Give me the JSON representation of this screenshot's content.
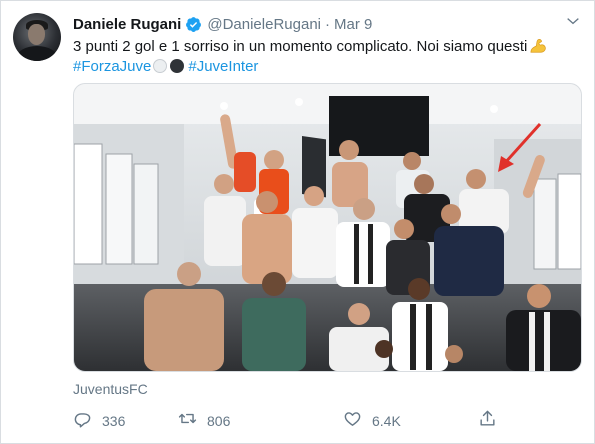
{
  "tweet": {
    "author_name": "Daniele Rugani",
    "handle": "@DanieleRugani",
    "separator": "·",
    "date": "Mar 9",
    "text_line1": "3 punti 2 gol e 1 sorriso in un momento complicato. Noi siamo questi",
    "hashtags": [
      "#ForzaJuve",
      "#JuveInter"
    ],
    "source": "JuventusFC",
    "stats": {
      "replies": "336",
      "retweets": "806",
      "likes": "6.4K"
    }
  },
  "icons": {
    "verified": "verified-badge-icon",
    "menu": "chevron-down-icon",
    "reply": "reply-icon",
    "retweet": "retweet-icon",
    "like": "heart-icon",
    "share": "share-icon",
    "emoji_1": "white-circle-emoji",
    "emoji_2": "black-circle-emoji",
    "emoji_3": "flexed-biceps-emoji"
  },
  "colors": {
    "link": "#1b95e0",
    "verified": "#1da1f2",
    "muted": "#657786",
    "text": "#14171a",
    "annotation_arrow": "#e0312b"
  }
}
